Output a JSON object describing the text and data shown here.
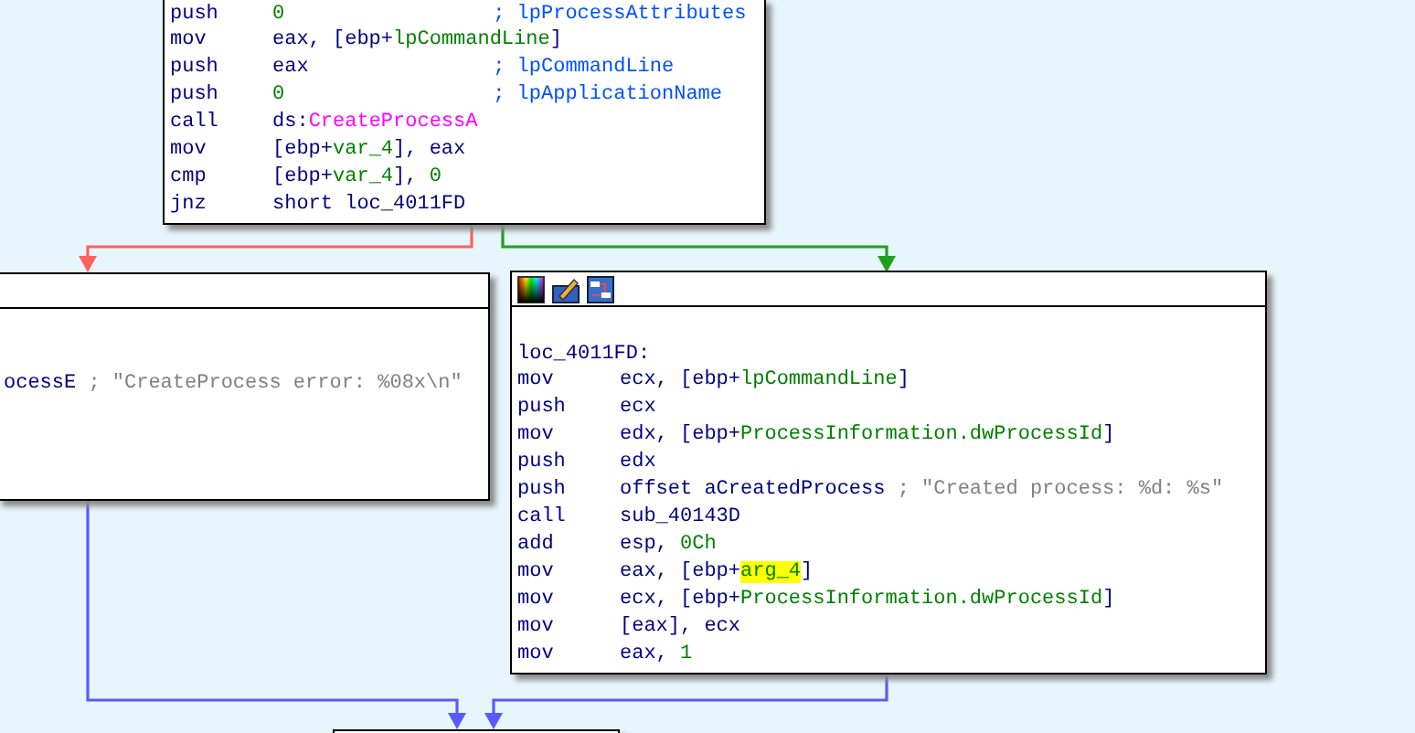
{
  "edges": [
    {
      "color": "#ff6060"
    },
    {
      "color": "#20a020"
    },
    {
      "color": "#5a5aff"
    },
    {
      "color": "#5a5aff"
    }
  ],
  "nodes": [
    {
      "lines": [
        {
          "mnemonic": "push",
          "operands": [
            {
              "text": "0",
              "kind": "number"
            }
          ],
          "comment": {
            "text": "; lpProcessAttributes",
            "kind": "ref"
          }
        },
        {
          "mnemonic": "mov",
          "operands": [
            {
              "text": "eax, [ebp+"
            },
            {
              "text": "lpCommandLine",
              "kind": "name"
            },
            {
              "text": "]"
            }
          ]
        },
        {
          "mnemonic": "push",
          "operands": [
            {
              "text": "eax"
            }
          ],
          "comment": {
            "text": "; lpCommandLine",
            "kind": "ref"
          }
        },
        {
          "mnemonic": "push",
          "operands": [
            {
              "text": "0",
              "kind": "number"
            }
          ],
          "comment": {
            "text": "; lpApplicationName",
            "kind": "ref"
          }
        },
        {
          "mnemonic": "call",
          "operands": [
            {
              "text": "ds:"
            },
            {
              "text": "CreateProcessA",
              "kind": "import"
            }
          ]
        },
        {
          "mnemonic": "mov",
          "operands": [
            {
              "text": "[ebp+"
            },
            {
              "text": "var_4",
              "kind": "name"
            },
            {
              "text": "], eax"
            }
          ]
        },
        {
          "mnemonic": "cmp",
          "operands": [
            {
              "text": "[ebp+"
            },
            {
              "text": "var_4",
              "kind": "name"
            },
            {
              "text": "], "
            },
            {
              "text": "0",
              "kind": "number"
            }
          ]
        },
        {
          "mnemonic": "jnz",
          "operands": [
            {
              "text": "short loc_4011FD"
            }
          ]
        }
      ]
    },
    {
      "lines": [
        {
          "operands": [
            {
              "text": "ocessE"
            }
          ],
          "comment": {
            "text": "; \"CreateProcess error: %08x\\n\"",
            "kind": "string"
          }
        }
      ]
    },
    {
      "lines": [
        {
          "label": "loc_4011FD:"
        },
        {
          "mnemonic": "mov",
          "operands": [
            {
              "text": "ecx, [ebp+"
            },
            {
              "text": "lpCommandLine",
              "kind": "name"
            },
            {
              "text": "]"
            }
          ]
        },
        {
          "mnemonic": "push",
          "operands": [
            {
              "text": "ecx"
            }
          ]
        },
        {
          "mnemonic": "mov",
          "operands": [
            {
              "text": "edx, [ebp+"
            },
            {
              "text": "ProcessInformation.dwProcessId",
              "kind": "name"
            },
            {
              "text": "]"
            }
          ]
        },
        {
          "mnemonic": "push",
          "operands": [
            {
              "text": "edx"
            }
          ]
        },
        {
          "mnemonic": "push",
          "operands": [
            {
              "text": "offset aCreatedProcess"
            }
          ],
          "comment": {
            "text": "; \"Created process: %d: %s\"",
            "kind": "string"
          }
        },
        {
          "mnemonic": "call",
          "operands": [
            {
              "text": "sub_40143D"
            }
          ]
        },
        {
          "mnemonic": "add",
          "operands": [
            {
              "text": "esp, "
            },
            {
              "text": "0Ch",
              "kind": "number"
            }
          ]
        },
        {
          "mnemonic": "mov",
          "operands": [
            {
              "text": "eax, [ebp+"
            },
            {
              "text": "arg_4",
              "kind": "highlight"
            },
            {
              "text": "]"
            }
          ]
        },
        {
          "mnemonic": "mov",
          "operands": [
            {
              "text": "ecx, [ebp+"
            },
            {
              "text": "ProcessInformation.dwProcessId",
              "kind": "name"
            },
            {
              "text": "]"
            }
          ]
        },
        {
          "mnemonic": "mov",
          "operands": [
            {
              "text": "[eax], ecx"
            }
          ]
        },
        {
          "mnemonic": "mov",
          "operands": [
            {
              "text": "eax, "
            },
            {
              "text": "1",
              "kind": "number"
            }
          ]
        }
      ]
    }
  ]
}
